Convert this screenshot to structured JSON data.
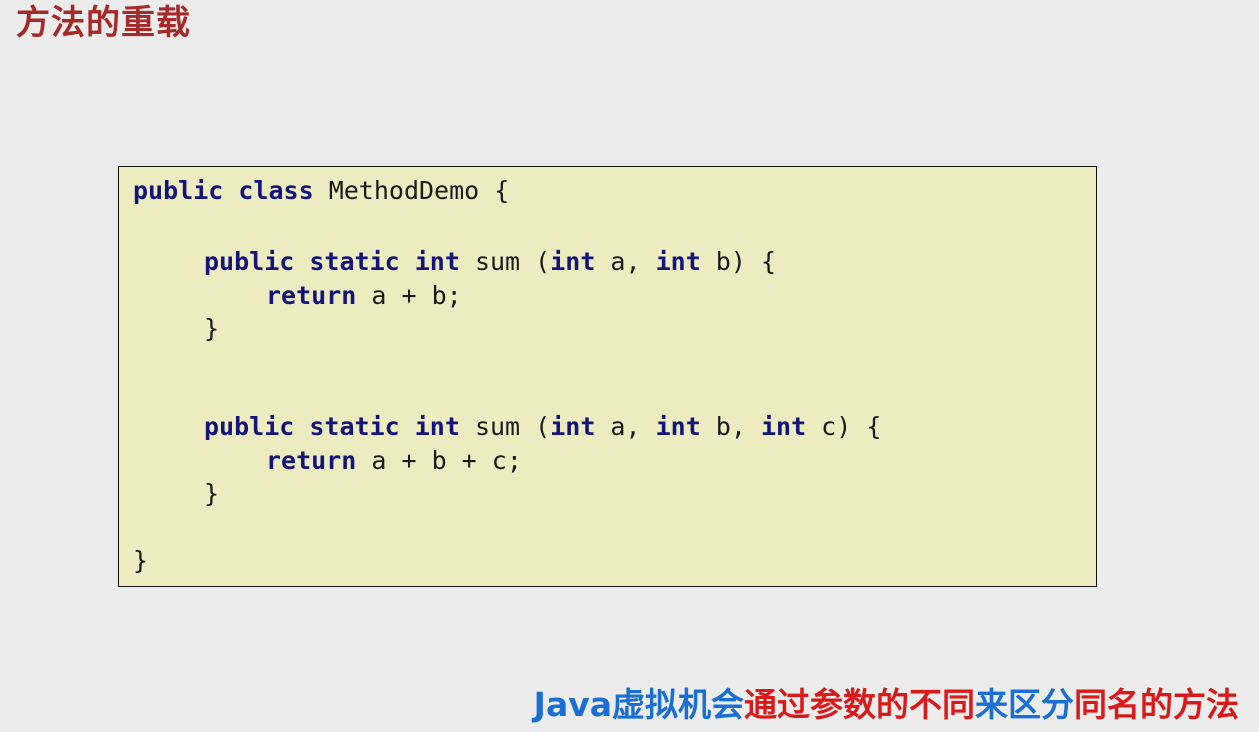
{
  "title": "方法的重载",
  "code_lines": [
    {
      "tokens": [
        {
          "t": "public",
          "kw": true
        },
        {
          "t": " "
        },
        {
          "t": "class",
          "kw": true
        },
        {
          "t": " MethodDemo {"
        }
      ]
    },
    {
      "tokens": [
        {
          "t": "public",
          "kw": true
        },
        {
          "t": " "
        },
        {
          "t": "static",
          "kw": true
        },
        {
          "t": " "
        },
        {
          "t": "int",
          "kw": true
        },
        {
          "t": " sum ("
        },
        {
          "t": "int",
          "kw": true
        },
        {
          "t": " a, "
        },
        {
          "t": "int",
          "kw": true
        },
        {
          "t": " b) {"
        }
      ]
    },
    {
      "tokens": [
        {
          "t": "return",
          "kw": true
        },
        {
          "t": " a + b;"
        }
      ]
    },
    {
      "tokens": [
        {
          "t": "}"
        }
      ]
    },
    {
      "tokens": [
        {
          "t": "public",
          "kw": true
        },
        {
          "t": " "
        },
        {
          "t": "static",
          "kw": true
        },
        {
          "t": " "
        },
        {
          "t": "int",
          "kw": true
        },
        {
          "t": " sum ("
        },
        {
          "t": "int",
          "kw": true
        },
        {
          "t": " a, "
        },
        {
          "t": "int",
          "kw": true
        },
        {
          "t": " b, "
        },
        {
          "t": "int",
          "kw": true
        },
        {
          "t": " c) {"
        }
      ]
    },
    {
      "tokens": [
        {
          "t": "return",
          "kw": true
        },
        {
          "t": " a + b + c;"
        }
      ]
    },
    {
      "tokens": [
        {
          "t": "}"
        }
      ]
    },
    {
      "tokens": [
        {
          "t": "}"
        }
      ]
    }
  ],
  "caption": [
    {
      "text": "Java虚拟机会",
      "color": "#1a6fd6"
    },
    {
      "text": "通过参数的",
      "color": "#d91a1a"
    },
    {
      "text": "不同",
      "color": "#d91a1a"
    },
    {
      "text": "来区分",
      "color": "#1a6fd6"
    },
    {
      "text": "同名的方法",
      "color": "#d91a1a"
    }
  ],
  "colors": {
    "title": "#a52a2a",
    "keyword": "#14147a",
    "code_background": "#ececc0",
    "page_background": "#ececec"
  }
}
